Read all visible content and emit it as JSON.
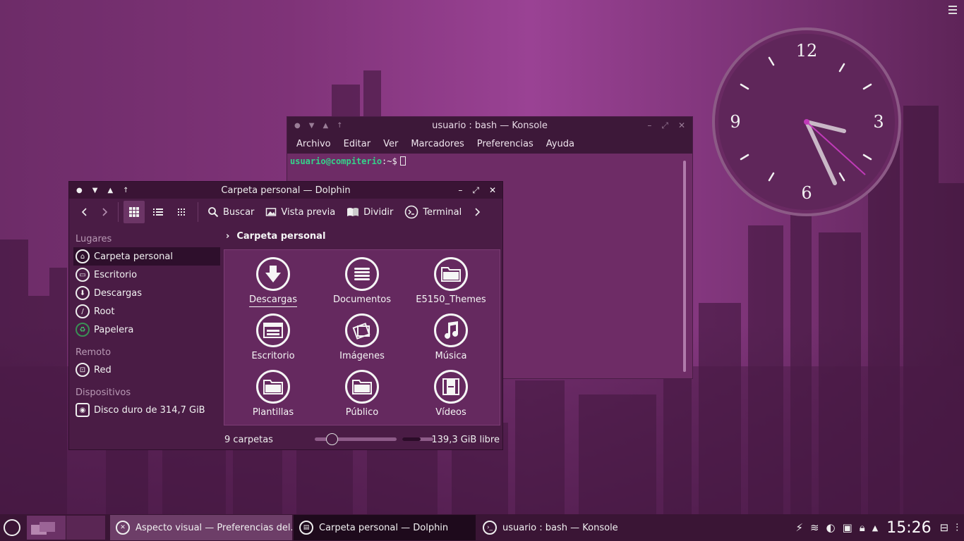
{
  "desktop": {
    "accent": "#7f3378"
  },
  "clock": {
    "numerals": {
      "twelve": "12",
      "three": "3",
      "six": "6",
      "nine": "9"
    }
  },
  "konsole": {
    "title": "usuario : bash — Konsole",
    "menu": [
      "Archivo",
      "Editar",
      "Ver",
      "Marcadores",
      "Preferencias",
      "Ayuda"
    ],
    "prompt_user": "usuario@compiterio",
    "prompt_path": ":~$"
  },
  "dolphin": {
    "title": "Carpeta personal — Dolphin",
    "toolbar": {
      "search": "Buscar",
      "preview": "Vista previa",
      "split": "Dividir",
      "terminal": "Terminal"
    },
    "places": {
      "heading": "Lugares",
      "items": [
        "Carpeta personal",
        "Escritorio",
        "Descargas",
        "Root",
        "Papelera"
      ]
    },
    "remote": {
      "heading": "Remoto",
      "items": [
        "Red"
      ]
    },
    "devices": {
      "heading": "Dispositivos",
      "items": [
        "Disco duro de 314,7 GiB"
      ]
    },
    "breadcrumb": "Carpeta personal",
    "folders": [
      "Descargas",
      "Documentos",
      "E5150_Themes",
      "Escritorio",
      "Imágenes",
      "Música",
      "Plantillas",
      "Público",
      "Vídeos"
    ],
    "status": {
      "count": "9 carpetas",
      "free": "139,3 GiB libre",
      "used_fraction": 0.58
    }
  },
  "panel": {
    "tasks": [
      "Aspecto visual  — Preferencias del...",
      "Carpeta personal — Dolphin",
      "usuario : bash — Konsole"
    ],
    "time": "15:26"
  }
}
